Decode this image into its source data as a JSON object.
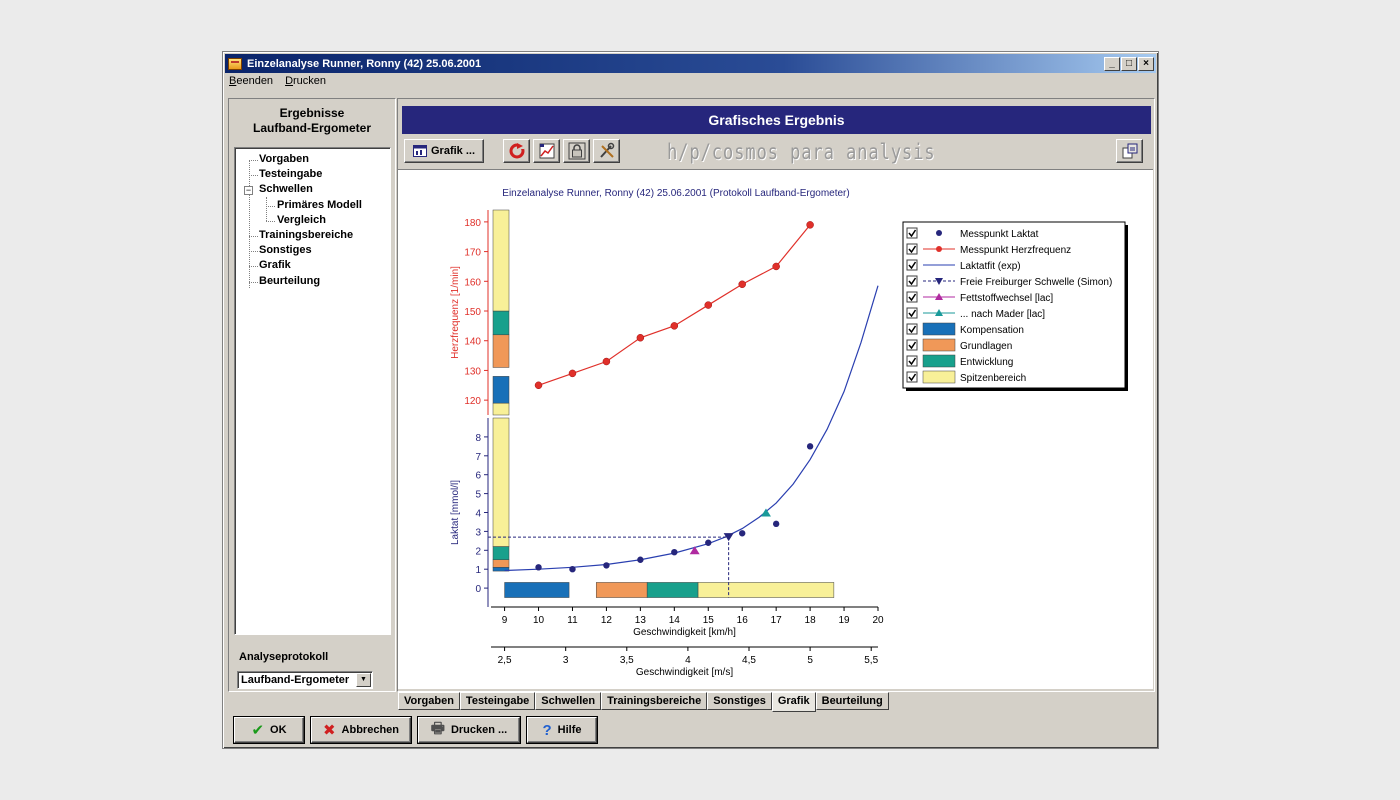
{
  "window": {
    "title": "Einzelanalyse Runner, Ronny (42) 25.06.2001",
    "minimize_glyph": "_",
    "maximize_glyph": "□",
    "close_glyph": "×"
  },
  "menu": {
    "items": [
      "Beenden",
      "Drucken"
    ]
  },
  "left_panel": {
    "title_line1": "Ergebnisse",
    "title_line2": "Laufband-Ergometer",
    "tree": [
      "Vorgaben",
      "Testeingabe",
      "Schwellen",
      "Primäres Modell",
      "Vergleich",
      "Trainingsbereiche",
      "Sonstiges",
      "Grafik",
      "Beurteilung"
    ],
    "tree_toggle": "−",
    "protocol_label": "Analyseprotokoll",
    "protocol_value": "Laufband-Ergometer"
  },
  "banner": {
    "title": "Grafisches Ergebnis"
  },
  "toolbar": {
    "grafik_label": "Grafik ...",
    "brand": "h/p/cosmos para analysis",
    "icons": [
      "refresh-icon",
      "chart-options-icon",
      "lock-icon",
      "tools-icon",
      "export-icon"
    ]
  },
  "tabs": [
    "Vorgaben",
    "Testeingabe",
    "Schwellen",
    "Trainingsbereiche",
    "Sonstiges",
    "Grafik",
    "Beurteilung"
  ],
  "active_tab": "Grafik",
  "buttons": {
    "ok": "OK",
    "cancel": "Abbrechen",
    "print": "Drucken ...",
    "help": "Hilfe"
  },
  "icons": {
    "ok": "check-icon",
    "cancel": "cross-icon",
    "print": "printer-icon",
    "help": "question-icon",
    "ok_glyph": "✔",
    "cancel_glyph": "✖",
    "print_glyph": "🖶",
    "help_glyph": "?"
  },
  "colors": {
    "lactate": "#26267c",
    "heartrate": "#e0302a",
    "fit": "#2a3fb0",
    "threshold": "#26267c",
    "fat": "#b02aa0",
    "mader": "#1a9a9a",
    "kompensation": "#1870b8",
    "grundlagen": "#f09858",
    "entwicklung": "#18a08c",
    "spitzenbereich": "#f8f098"
  },
  "chart_data": {
    "type": "line",
    "title": "Einzelanalyse Runner, Ronny (42) 25.06.2001 (Protokoll Laufband-Ergometer)",
    "xlabel": "Geschwindigkeit [km/h]",
    "xlabel2": "Geschwindigkeit [m/s]",
    "ylabel_lactate": "Laktat [mmol/l]",
    "ylabel_hr": "Herzfrequenz [1/min]",
    "x_ticks": [
      9,
      10,
      11,
      12,
      13,
      14,
      15,
      16,
      17,
      18,
      19,
      20
    ],
    "x2_ticks": [
      "2,5",
      "3",
      "3,5",
      "4",
      "4,5",
      "5",
      "5,5"
    ],
    "x2_values": [
      2.5,
      3,
      3.5,
      4,
      4.5,
      5,
      5.5
    ],
    "y_lactate_ticks": [
      0,
      1,
      2,
      3,
      4,
      5,
      6,
      7,
      8
    ],
    "y_hr_ticks": [
      120,
      130,
      140,
      150,
      160,
      170,
      180
    ],
    "xlim": [
      8.6,
      20
    ],
    "lactate_range": [
      -1,
      9
    ],
    "hr_range": [
      115,
      184
    ],
    "series": [
      {
        "name": "Messpunkt Laktat",
        "x": [
          10,
          11,
          12,
          13,
          14,
          15,
          16,
          17,
          18
        ],
        "y": [
          1.1,
          1.0,
          1.2,
          1.5,
          1.9,
          2.4,
          2.9,
          3.4,
          7.5
        ]
      },
      {
        "name": "Messpunkt Herzfrequenz",
        "x": [
          10,
          11,
          12,
          13,
          14,
          15,
          16,
          17,
          18
        ],
        "y": [
          125,
          129,
          133,
          141,
          145,
          152,
          159,
          165,
          179
        ]
      },
      {
        "name": "Laktatfit (exp)",
        "x": [
          9,
          10,
          11,
          12,
          13,
          14,
          15,
          15.5,
          16,
          16.5,
          17,
          17.5,
          18,
          18.5,
          19,
          19.5,
          20
        ],
        "y": [
          0.93,
          1.0,
          1.1,
          1.25,
          1.5,
          1.85,
          2.35,
          2.7,
          3.15,
          3.75,
          4.5,
          5.5,
          6.8,
          8.4,
          10.4,
          13,
          16
        ]
      },
      {
        "name": "Freie Freiburger Schwelle (Simon)",
        "x": [
          15.6
        ],
        "y": [
          2.7
        ]
      },
      {
        "name": "Fettstoffwechsel [lac]",
        "x": [
          14.6
        ],
        "y": [
          2.0
        ]
      },
      {
        "name": "... nach Mader [lac]",
        "x": [
          16.7
        ],
        "y": [
          4.0
        ]
      }
    ],
    "zones_horizontal": [
      {
        "name": "Kompensation",
        "from": 9.0,
        "to": 10.9
      },
      {
        "name": "Grundlagen",
        "from": 11.7,
        "to": 13.2
      },
      {
        "name": "Entwicklung",
        "from": 13.2,
        "to": 14.7
      },
      {
        "name": "Spitzenbereich",
        "from": 14.7,
        "to": 18.7
      }
    ],
    "zones_lactate_bar": [
      {
        "name": "Kompensation",
        "from": 0.9,
        "to": 1.1
      },
      {
        "name": "Grundlagen",
        "from": 1.1,
        "to": 1.5
      },
      {
        "name": "Entwicklung",
        "from": 1.5,
        "to": 2.2
      },
      {
        "name": "Spitzenbereich",
        "from": 2.2,
        "to": 9.0
      }
    ],
    "zones_hr_bar": [
      {
        "name": "Spitzenbereich",
        "from": 115,
        "to": 119
      },
      {
        "name": "Kompensation",
        "from": 119,
        "to": 128
      },
      {
        "name": "Grundlagen",
        "from": 131,
        "to": 142
      },
      {
        "name": "Entwicklung",
        "from": 142,
        "to": 150
      },
      {
        "name": "Spitzenbereich",
        "from": 150,
        "to": 184
      }
    ],
    "legend": {
      "position": "top-right",
      "entries": [
        "Messpunkt Laktat",
        "Messpunkt Herzfrequenz",
        "Laktatfit (exp)",
        "Freie Freiburger Schwelle (Simon)",
        "Fettstoffwechsel [lac]",
        "... nach Mader [lac]",
        "Kompensation",
        "Grundlagen",
        "Entwicklung",
        "Spitzenbereich"
      ],
      "checked": true
    }
  }
}
